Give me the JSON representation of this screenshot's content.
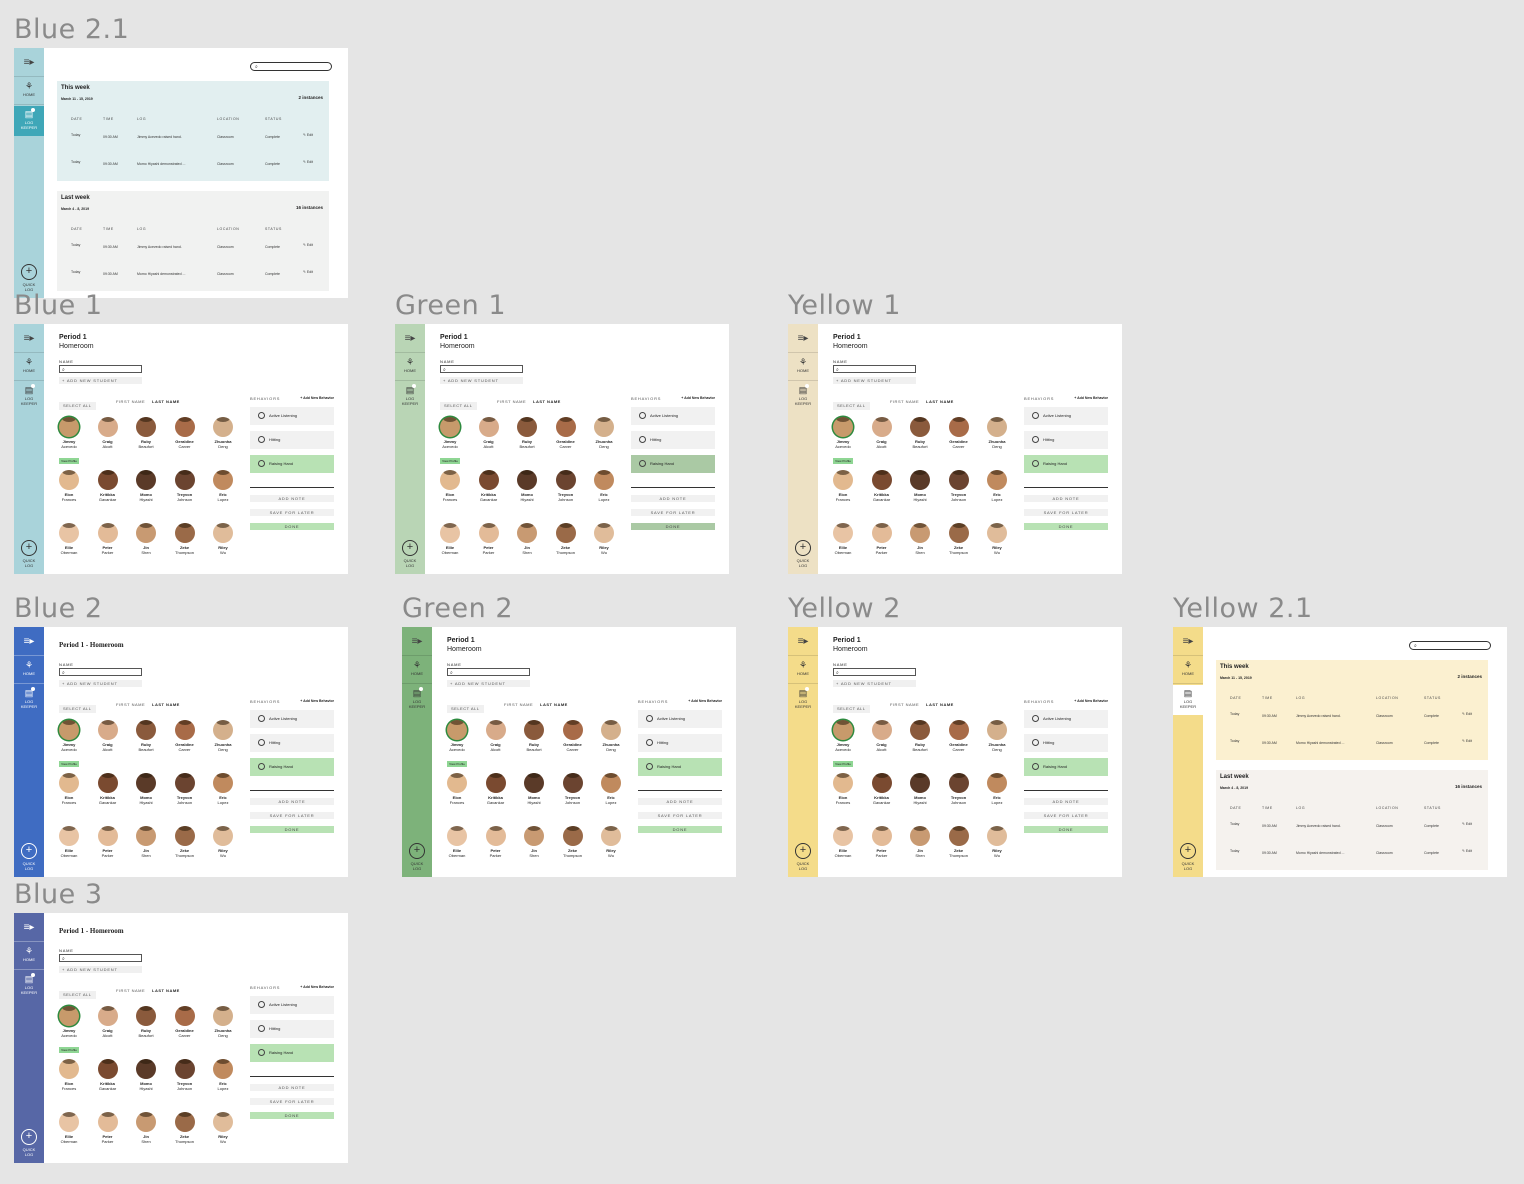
{
  "frames": {
    "blue21": "Blue 2.1",
    "blue1": "Blue 1",
    "green1": "Green 1",
    "yellow1": "Yellow 1",
    "blue2": "Blue 2",
    "green2": "Green 2",
    "yellow2": "Yellow 2",
    "yellow21": "Yellow 2.1",
    "blue3": "Blue 3"
  },
  "colors": {
    "blue1": "#a9d3da",
    "blue21": "#a9d3da",
    "green1": "#b9d5b5",
    "yellow1": "#ede1c4",
    "blue2": "#3f6cc2",
    "green2": "#7db27a",
    "yellow2": "#f4dc8a",
    "yellow21": "#f4dc8a",
    "blue3": "#5767a6",
    "log_active": "#3fa7b8",
    "green_accent": "#b8e2b4",
    "card_blue": "#e2eff0",
    "card_grey": "#f1f2f1",
    "card_yellow": "#fbf0d0",
    "card_grey_y": "#f5f2ee"
  },
  "sidebar": {
    "menu_icon": "menu-icon",
    "home_label": "HOME",
    "log_label_1": "LOG",
    "log_label_2": "KEEPER",
    "log_badge": "1",
    "quick_label_1": "QUICK",
    "quick_label_2": "LOG",
    "quick_icon": "+"
  },
  "roster": {
    "period": "Period 1",
    "homeroom": "Homeroom",
    "period_combined": "Period 1 - Homeroom",
    "name_label": "NAME",
    "add_student": "+ ADD NEW STUDENT",
    "select_all": "SELECT ALL",
    "first_name": "FIRST NAME",
    "last_name": "LAST NAME",
    "view_profile": "View Profile",
    "students": [
      {
        "first": "Jimmy",
        "last": "Acevedo",
        "skin": "#c79a6b"
      },
      {
        "first": "Craig",
        "last": "Alcott",
        "skin": "#d8ab8a"
      },
      {
        "first": "Ruby",
        "last": "Beaufort",
        "skin": "#8a5a3c"
      },
      {
        "first": "Geraldine",
        "last": "Carver",
        "skin": "#a86b48"
      },
      {
        "first": "Zhuonha",
        "last": "Deng",
        "skin": "#d4b08c"
      },
      {
        "first": "Elon",
        "last": "Frances",
        "skin": "#e2b98f"
      },
      {
        "first": "Kritikka",
        "last": "Gavankar",
        "skin": "#7a4a30"
      },
      {
        "first": "Momo",
        "last": "Hiyashi",
        "skin": "#5a3a28"
      },
      {
        "first": "Treyvon",
        "last": "Johnson",
        "skin": "#6b4430"
      },
      {
        "first": "Eric",
        "last": "Lopez",
        "skin": "#c08a5e"
      },
      {
        "first": "Ellie",
        "last": "Oberman",
        "skin": "#e8c4a4"
      },
      {
        "first": "Peter",
        "last": "Parker",
        "skin": "#e3bb98"
      },
      {
        "first": "Jin",
        "last": "Shen",
        "skin": "#c89a72"
      },
      {
        "first": "Zeke",
        "last": "Thompson",
        "skin": "#9a6a48"
      },
      {
        "first": "Riley",
        "last": "Wu",
        "skin": "#e0bc9a"
      }
    ],
    "behaviors_label": "BEHAVIORS",
    "add_behavior": "+ Add New Behavior",
    "behaviors": [
      "Active Listening",
      "Hitting",
      "Raising Hand"
    ],
    "add_note": "ADD NOTE",
    "save_later": "SAVE FOR LATER",
    "done": "DONE"
  },
  "log": {
    "search_icon": "search-icon",
    "this_week": "This week",
    "this_week_dates": "March 11 - 15, 2019",
    "this_week_count": "2 instances",
    "last_week": "Last week",
    "last_week_dates": "March 4 - 8, 2019",
    "last_week_count": "16 instances",
    "headers": [
      "DATE",
      "TIME",
      "LOG",
      "LOCATION",
      "STATUS"
    ],
    "rows": [
      {
        "date": "Today",
        "time": "09:30 AM",
        "log": "Jimmy Acevedo raised hand.",
        "location": "Classroom",
        "status": "Complete",
        "edit": "Edit"
      },
      {
        "date": "Today",
        "time": "09:30 AM",
        "log": "Momo Hiyashi demonstrated ...",
        "location": "Classroom",
        "status": "Complete",
        "edit": "Edit"
      }
    ]
  }
}
